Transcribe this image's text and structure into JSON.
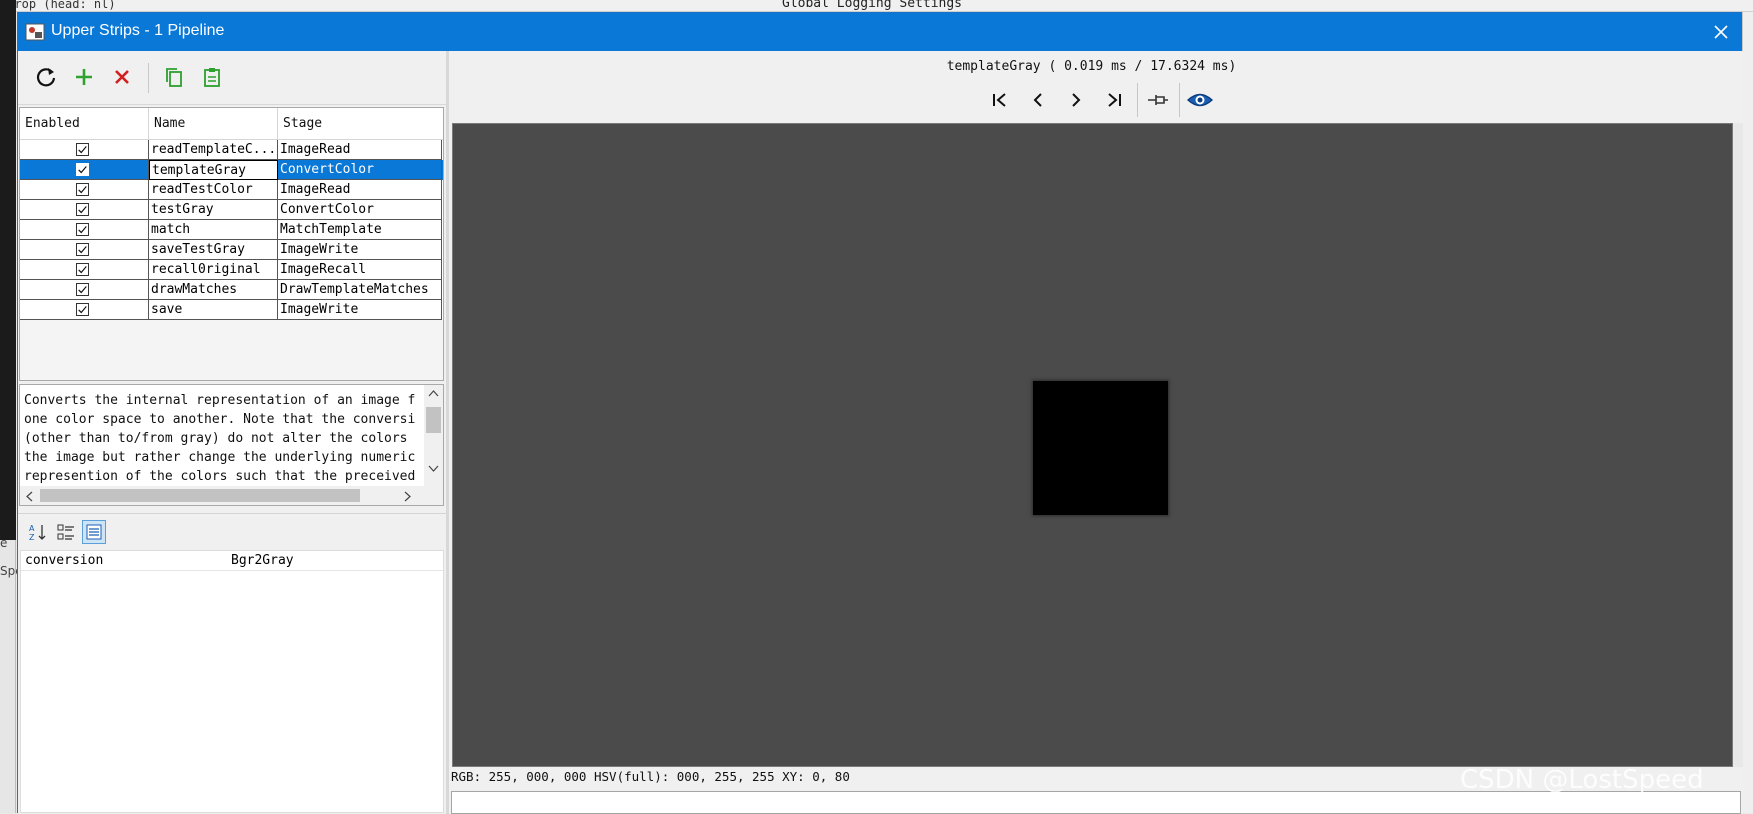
{
  "background": {
    "top_left_text": ": rop (head: nl)",
    "top_right_text": "Global Logging Settings",
    "left_text_e": "e",
    "left_text_spe": "Spe"
  },
  "window": {
    "title": "Upper Strips - 1 Pipeline"
  },
  "toolbar": {
    "refresh_icon": "refresh-icon",
    "add_icon": "plus-icon",
    "delete_icon": "x-icon",
    "copy_icon": "copy-icon",
    "paste_icon": "clipboard-icon"
  },
  "stages": {
    "columns": [
      "Enabled",
      "Name",
      "Stage"
    ],
    "rows": [
      {
        "enabled": true,
        "name": "readTemplateC...",
        "stage": "ImageRead"
      },
      {
        "enabled": true,
        "name": "templateGray",
        "stage": "ConvertColor",
        "selected": true
      },
      {
        "enabled": true,
        "name": "readTestColor",
        "stage": "ImageRead"
      },
      {
        "enabled": true,
        "name": "testGray",
        "stage": "ConvertColor"
      },
      {
        "enabled": true,
        "name": "match",
        "stage": "MatchTemplate"
      },
      {
        "enabled": true,
        "name": "saveTestGray",
        "stage": "ImageWrite"
      },
      {
        "enabled": true,
        "name": "recall0riginal",
        "stage": "ImageRecall"
      },
      {
        "enabled": true,
        "name": "drawMatches",
        "stage": "DrawTemplateMatches"
      },
      {
        "enabled": true,
        "name": "save",
        "stage": "ImageWrite"
      }
    ]
  },
  "description": {
    "lines": [
      "Converts the internal representation of an image f",
      "one color space to another. Note that the conversi",
      "(other than to/from gray) do not alter the colors",
      "the image but rather change the underlying numeric",
      "represention of the colors such that the preceived"
    ]
  },
  "properties": {
    "rows": [
      {
        "key": "conversion",
        "value": "Bgr2Gray"
      }
    ]
  },
  "viewer": {
    "title": "templateGray ( 0.019 ms / 17.6324 ms)",
    "status": "RGB: 255, 000, 000 HSV(full): 000, 255, 255 XY: 0, 80"
  },
  "watermark": "CSDN @LostSpeed",
  "colors": {
    "accent": "#0a78d7",
    "canvas": "#4b4b4b",
    "add_green": "#2ea12e",
    "delete_red": "#d21f1f"
  }
}
